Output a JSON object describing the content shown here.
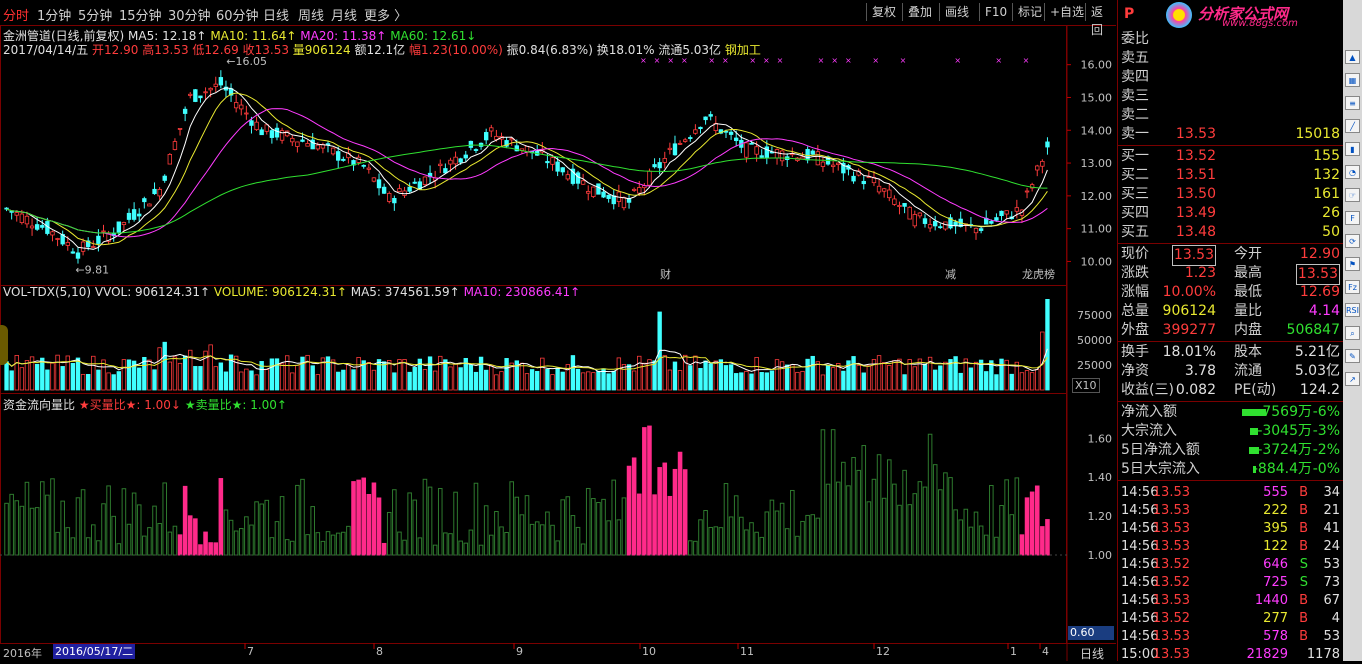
{
  "toolbar": {
    "periods": [
      "分时",
      "1分钟",
      "5分钟",
      "15分钟",
      "30分钟",
      "60分钟",
      "日线",
      "周线",
      "月线",
      "更多 〉"
    ],
    "active_index": 0,
    "tools": [
      "复权",
      "叠加",
      "画线",
      "F10",
      "标记",
      "+自选",
      "返回"
    ]
  },
  "header": {
    "line1_name": "金洲管道(日线,前复权)",
    "ma5": "MA5: 12.18↑",
    "ma10": "MA10: 11.64↑",
    "ma20": "MA20: 11.38↑",
    "ma60": "MA60: 12.61↓",
    "date": "2017/04/14/五",
    "open": "开12.90",
    "high": "高13.53",
    "low": "低12.69",
    "close": "收13.53",
    "vol": "量906124",
    "amount": "额12.1亿",
    "change": "幅1.23(10.00%)",
    "amp": "振0.84(6.83%)",
    "turnover": "换18.01%",
    "float": "流通5.03亿",
    "industry": "钢加工"
  },
  "price_axis": [
    "16.00",
    "15.00",
    "14.00",
    "13.00",
    "12.00",
    "11.00",
    "10.00"
  ],
  "price_annotations": {
    "high": "16.05",
    "low": "9.81"
  },
  "event_marks": [
    "财",
    "减",
    "龙虎榜"
  ],
  "volume_header": {
    "name": "VOL-TDX(5,10)",
    "vvol": "VVOL: 906124.31↑",
    "volume": "VOLUME: 906124.31↑",
    "ma5": "MA5: 374561.59↑",
    "ma10": "MA10: 230866.41↑"
  },
  "volume_axis": [
    "75000",
    "50000",
    "25000"
  ],
  "volume_unit": "X10",
  "flow_header": {
    "name": "资金流向量比",
    "buy": "★买量比★: 1.00↓",
    "sell": "★卖量比★: 1.00↑"
  },
  "flow_axis": [
    "1.60",
    "1.40",
    "1.20",
    "1.00"
  ],
  "flow_cursor_value": "0.60",
  "date_axis": {
    "year": "2016年",
    "cursor_date": "2016/05/17/二",
    "months": [
      "7",
      "8",
      "9",
      "10",
      "11",
      "12",
      "1",
      "4"
    ],
    "period_label": "日线"
  },
  "panel": {
    "logo_text": "分析家公式网",
    "logo_url": "www.88gs.com",
    "weibi_label": "委比",
    "asks": [
      {
        "label": "卖五",
        "price": "",
        "vol": ""
      },
      {
        "label": "卖四",
        "price": "",
        "vol": ""
      },
      {
        "label": "卖三",
        "price": "",
        "vol": ""
      },
      {
        "label": "卖二",
        "price": "",
        "vol": ""
      },
      {
        "label": "卖一",
        "price": "13.53",
        "vol": "15018"
      }
    ],
    "bids": [
      {
        "label": "买一",
        "price": "13.52",
        "vol": "155"
      },
      {
        "label": "买二",
        "price": "13.51",
        "vol": "132"
      },
      {
        "label": "买三",
        "price": "13.50",
        "vol": "161"
      },
      {
        "label": "买四",
        "price": "13.49",
        "vol": "26"
      },
      {
        "label": "买五",
        "price": "13.48",
        "vol": "50"
      }
    ],
    "quote": [
      {
        "l1": "现价",
        "v1": "13.53",
        "l2": "今开",
        "v2": "12.90"
      },
      {
        "l1": "涨跌",
        "v1": "1.23",
        "l2": "最高",
        "v2": "13.53"
      },
      {
        "l1": "涨幅",
        "v1": "10.00%",
        "l2": "最低",
        "v2": "12.69"
      },
      {
        "l1": "总量",
        "v1": "906124",
        "l2": "量比",
        "v2": "4.14"
      },
      {
        "l1": "外盘",
        "v1": "399277",
        "l2": "内盘",
        "v2": "506847"
      }
    ],
    "finance": [
      {
        "l1": "换手",
        "v1": "18.01%",
        "l2": "股本",
        "v2": "5.21亿"
      },
      {
        "l1": "净资",
        "v1": "3.78",
        "l2": "流通",
        "v2": "5.03亿"
      },
      {
        "l1": "收益(三)",
        "v1": "0.082",
        "l2": "PE(动)",
        "v2": "124.2"
      }
    ],
    "flows": [
      {
        "label": "净流入额",
        "value": "-7569万",
        "pct": "-6%",
        "bar": 0.6
      },
      {
        "label": "大宗流入",
        "value": "-3045万",
        "pct": "-3%",
        "bar": 0.2
      },
      {
        "label": "5日净流入额",
        "value": "-3724万",
        "pct": "-2%",
        "bar": 0.25
      },
      {
        "label": "5日大宗流入",
        "value": "-884.4万",
        "pct": "-0%",
        "bar": 0.05
      }
    ],
    "ticks": [
      {
        "time": "14:56",
        "price": "13.53",
        "vol": "555",
        "side": "B",
        "n": "34"
      },
      {
        "time": "14:56",
        "price": "13.53",
        "vol": "222",
        "side": "B",
        "n": "21"
      },
      {
        "time": "14:56",
        "price": "13.53",
        "vol": "395",
        "side": "B",
        "n": "41"
      },
      {
        "time": "14:56",
        "price": "13.53",
        "vol": "122",
        "side": "B",
        "n": "24"
      },
      {
        "time": "14:56",
        "price": "13.52",
        "vol": "646",
        "side": "S",
        "n": "53"
      },
      {
        "time": "14:56",
        "price": "13.52",
        "vol": "725",
        "side": "S",
        "n": "73"
      },
      {
        "time": "14:56",
        "price": "13.53",
        "vol": "1440",
        "side": "B",
        "n": "67"
      },
      {
        "time": "14:56",
        "price": "13.52",
        "vol": "277",
        "side": "B",
        "n": "4"
      },
      {
        "time": "14:56",
        "price": "13.53",
        "vol": "578",
        "side": "B",
        "n": "53"
      },
      {
        "time": "15:00",
        "price": "13.53",
        "vol": "21829",
        "side": "",
        "n": "1178"
      }
    ]
  },
  "colors": {
    "up": "#ff3c3c",
    "down": "#40ffff",
    "ma5": "#ffffff",
    "ma10": "#e8e830",
    "ma20": "#ff3cff",
    "ma60": "#30e030",
    "frame": "#7a0000",
    "buy_bar": "#ff2a8a",
    "sell_bar": "#2e7a2e"
  }
}
